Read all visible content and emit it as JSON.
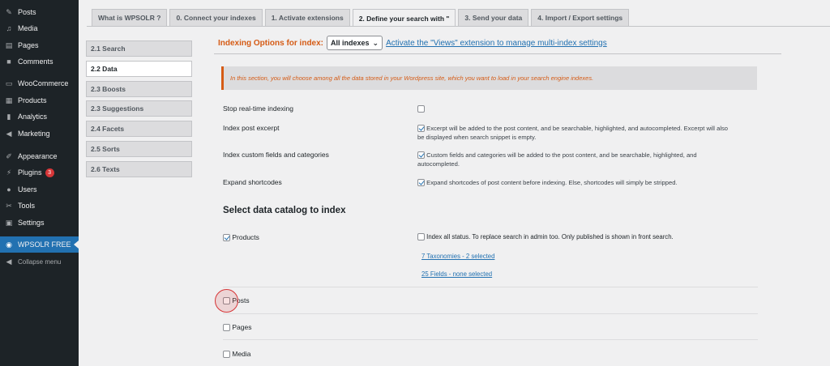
{
  "sidebar": {
    "items": [
      {
        "label": "Posts",
        "icon": "pin-icon"
      },
      {
        "label": "Media",
        "icon": "media-icon"
      },
      {
        "label": "Pages",
        "icon": "pages-icon"
      },
      {
        "label": "Comments",
        "icon": "comments-icon"
      },
      {
        "label": "WooCommerce",
        "icon": "woocommerce-icon"
      },
      {
        "label": "Products",
        "icon": "products-icon"
      },
      {
        "label": "Analytics",
        "icon": "analytics-icon"
      },
      {
        "label": "Marketing",
        "icon": "marketing-icon"
      },
      {
        "label": "Appearance",
        "icon": "appearance-icon"
      },
      {
        "label": "Plugins",
        "icon": "plugins-icon",
        "badge": "3"
      },
      {
        "label": "Users",
        "icon": "users-icon"
      },
      {
        "label": "Tools",
        "icon": "tools-icon"
      },
      {
        "label": "Settings",
        "icon": "settings-icon"
      },
      {
        "label": "WPSOLR FREE",
        "icon": "wpsolr-icon",
        "active": true
      }
    ],
    "collapse_label": "Collapse menu"
  },
  "tabs": [
    {
      "label": "What is WPSOLR ?"
    },
    {
      "label": "0. Connect your indexes"
    },
    {
      "label": "1. Activate extensions"
    },
    {
      "label": "2. Define your search with \""
    },
    {
      "label": "3. Send your data"
    },
    {
      "label": "4. Import / Export settings"
    }
  ],
  "subnav": [
    {
      "label": "2.1 Search"
    },
    {
      "label": "2.2 Data"
    },
    {
      "label": "2.3 Boosts"
    },
    {
      "label": "2.3 Suggestions"
    },
    {
      "label": "2.4 Facets"
    },
    {
      "label": "2.5 Sorts"
    },
    {
      "label": "2.6 Texts"
    }
  ],
  "indexing": {
    "label": "Indexing Options for index:",
    "select_value": "All indexes",
    "views_link": "Activate the \"Views\" extension to manage multi-index settings"
  },
  "notice": "In this section, you will choose among all the data stored in your Wordpress site, which you want to load in your search engine indexes.",
  "options": [
    {
      "label": "Stop real-time indexing",
      "text": ""
    },
    {
      "label": "Index post excerpt",
      "text": "Excerpt will be added to the post content, and be searchable, highlighted, and autocompleted. Excerpt will also be displayed when search snippet is empty."
    },
    {
      "label": "Index custom fields and categories",
      "text": "Custom fields and categories will be added to the post content, and be searchable, highlighted, and autocompleted."
    },
    {
      "label": "Expand shortcodes",
      "text": "Expand shortcodes of post content before indexing. Else, shortcodes will simply be stripped."
    }
  ],
  "catalog": {
    "title": "Select data catalog to index",
    "products_label": "Products",
    "index_all_status": "Index all status. To replace search in admin too. Only published is shown in front search.",
    "taxonomies_link": "7 Taxonomies - 2 selected",
    "fields_link": "25 Fields - none selected",
    "posts_label": "Posts",
    "pages_label": "Pages",
    "media_label": "Media"
  }
}
